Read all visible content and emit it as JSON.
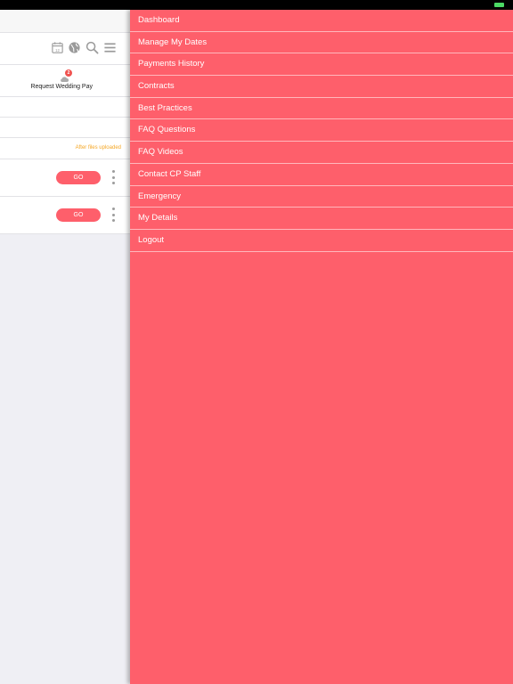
{
  "colors": {
    "accent": "#fe5f6b",
    "note": "#f5a623",
    "badge": "#f0524f",
    "status_ok": "#4cd964"
  },
  "toolbar": {
    "icons": [
      "calendar-icon",
      "globe-icon",
      "search-icon",
      "menu-icon"
    ],
    "calendar_day": "12"
  },
  "request_pay": {
    "badge_count": "2",
    "label": "Request Wedding Pay"
  },
  "note": "After files uploaded",
  "items": [
    {
      "go_label": "GO"
    },
    {
      "go_label": "GO"
    }
  ],
  "menu": [
    {
      "label": "Dashboard"
    },
    {
      "label": "Manage My Dates"
    },
    {
      "label": "Payments History"
    },
    {
      "label": "Contracts"
    },
    {
      "label": "Best Practices"
    },
    {
      "label": "FAQ Questions"
    },
    {
      "label": "FAQ Videos"
    },
    {
      "label": "Contact CP Staff"
    },
    {
      "label": "Emergency"
    },
    {
      "label": "My Details"
    },
    {
      "label": "Logout"
    }
  ]
}
